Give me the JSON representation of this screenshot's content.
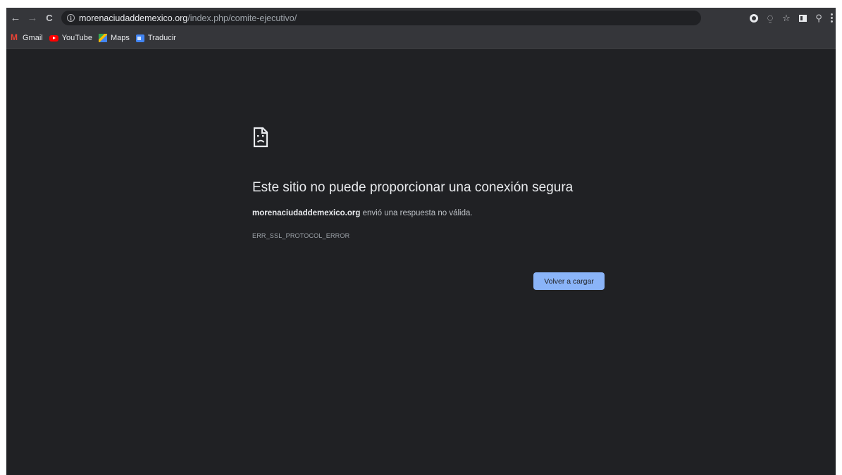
{
  "toolbar": {
    "back_icon": "back-arrow-icon",
    "forward_icon": "forward-arrow-icon",
    "reload_icon": "reload-icon",
    "back_glyph": "←",
    "forward_glyph": "→",
    "reload_glyph": "C",
    "url_host": "morenaciudaddemexico.org",
    "url_path": "/index.php/comite-ejecutivo/",
    "share_glyph": "⍜",
    "star_glyph": "☆",
    "extensions_glyph": "⚲"
  },
  "bookmarks": [
    {
      "label": "Gmail",
      "icon": "gmail-icon"
    },
    {
      "label": "YouTube",
      "icon": "youtube-icon"
    },
    {
      "label": "Maps",
      "icon": "maps-icon"
    },
    {
      "label": "Traducir",
      "icon": "translate-icon"
    }
  ],
  "error": {
    "icon": "sad-page-icon",
    "title": "Este sitio no puede proporcionar una conexión segura",
    "host": "morenaciudaddemexico.org",
    "message": " envió una respuesta no válida.",
    "code": "ERR_SSL_PROTOCOL_ERROR",
    "reload_label": "Volver a cargar"
  },
  "colors": {
    "page_bg": "#202124",
    "toolbar_bg": "#35363a",
    "accent_button": "#8ab4f8"
  }
}
